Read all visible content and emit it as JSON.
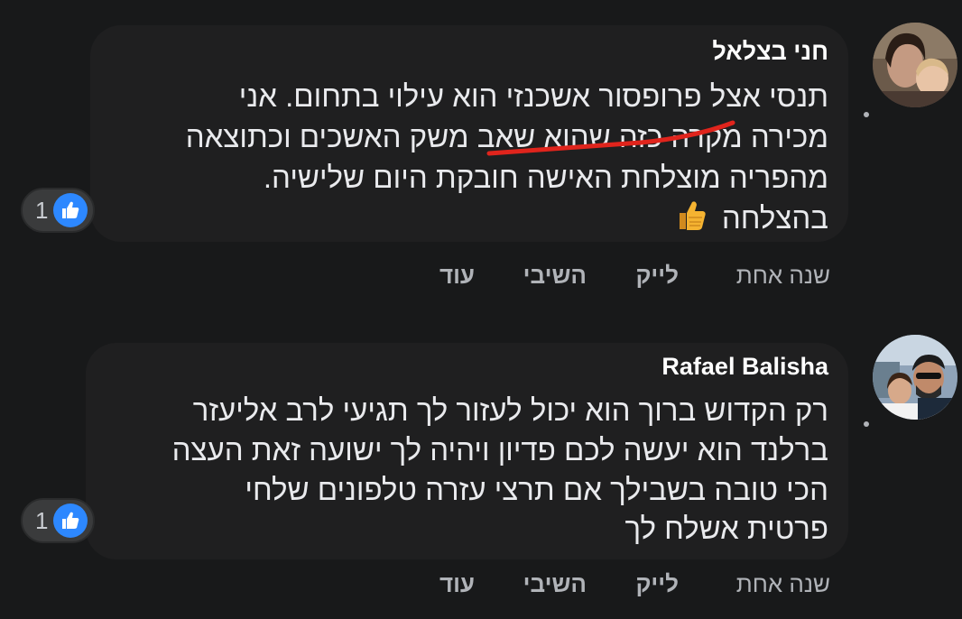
{
  "colors": {
    "background": "#18191a",
    "bubble": "#1f1f20",
    "like_blue": "#2d88ff",
    "annotation_red": "#e0241c"
  },
  "comments": [
    {
      "author": "חני בצלאל",
      "lines": [
        "תנסי אצל פרופסור אשכנזי הוא עילוי בתחום. אני",
        "מכירה מקרה כזה שהוא שאב משק האשכים וכתוצאה",
        "מהפריה מוצלחת האישה חובקת היום שלישיה.",
        "בהצלחה"
      ],
      "emoji": "thumbs-up-emoji",
      "reaction_count": "1",
      "time": "שנה אחת",
      "like_label": "לייק",
      "reply_label": "השיבי",
      "more_label": "עוד"
    },
    {
      "author": "Rafael Balisha",
      "lines": [
        "רק הקדוש ברוך הוא יכול לעזור לך תגיעי לרב אליעזר",
        "ברלנד הוא יעשה לכם פדיון ויהיה לך ישועה זאת העצה",
        "הכי טובה בשבילך אם תרצי עזרה טלפונים שלחי",
        "פרטית אשלח לך"
      ],
      "reaction_count": "1",
      "time": "שנה אחת",
      "like_label": "לייק",
      "reply_label": "השיבי",
      "more_label": "עוד"
    }
  ]
}
